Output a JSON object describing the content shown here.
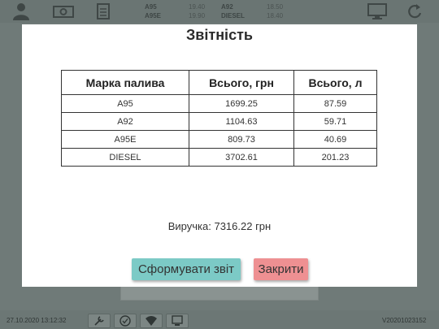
{
  "topbar": {
    "prices": [
      {
        "fuel": "A95",
        "price": "19.40"
      },
      {
        "fuel": "A95E",
        "price": "19.90"
      },
      {
        "fuel": "A92",
        "price": "18.50"
      },
      {
        "fuel": "DIESEL",
        "price": "18.40"
      }
    ]
  },
  "modal": {
    "title": "Звітність",
    "table": {
      "headers": [
        "Марка палива",
        "Всього, грн",
        "Всього, л"
      ],
      "rows": [
        [
          "A95",
          "1699.25",
          "87.59"
        ],
        [
          "A92",
          "1104.63",
          "59.71"
        ],
        [
          "A95E",
          "809.73",
          "40.69"
        ],
        [
          "DIESEL",
          "3702.61",
          "201.23"
        ]
      ]
    },
    "revenue": "Виручка: 7316.22 грн",
    "generate_label": "Сформувати звіт",
    "close_label": "Закрити"
  },
  "statusbar": {
    "datetime": "27.10.2020 13:12:32",
    "version": "V20201023152"
  },
  "colors": {
    "generate": "#7ccac6",
    "close": "#ee9092",
    "overlay": "#6f7a78"
  }
}
